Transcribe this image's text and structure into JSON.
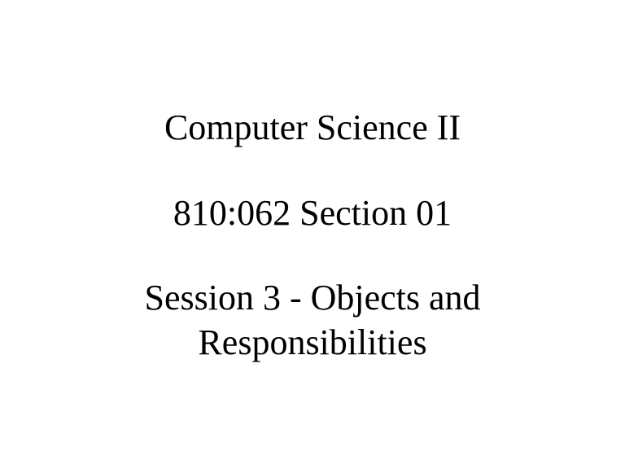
{
  "slide": {
    "title": "Computer Science II",
    "course_section": "810:062 Section 01",
    "session": "Session 3 - Objects and Responsibilities"
  }
}
